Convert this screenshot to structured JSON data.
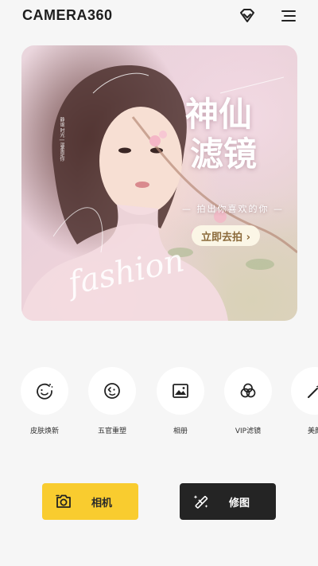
{
  "header": {
    "logo": "CAMERA360",
    "vip_icon": "diamond-icon",
    "menu_icon": "menu-icon"
  },
  "banner": {
    "title_line1": "神仙",
    "title_line2": "滤镜",
    "subtitle": "— 拍出你喜欢的你 —",
    "button_label": "立即去拍 ›",
    "script_text": "fashion",
    "side_text": "静谧 时光 | 温柔是你"
  },
  "features": [
    {
      "label": "皮肤焕新",
      "icon": "face-refresh-icon"
    },
    {
      "label": "五官重塑",
      "icon": "face-reshape-icon"
    },
    {
      "label": "相册",
      "icon": "image-icon"
    },
    {
      "label": "VIP滤镜",
      "icon": "filter-circles-icon"
    },
    {
      "label": "美颜",
      "icon": "magic-wand-icon"
    }
  ],
  "actions": {
    "camera_label": "相机",
    "edit_label": "修图"
  },
  "colors": {
    "accent_yellow": "#f9cc2f",
    "dark_button": "#242424",
    "background": "#f6f6f6"
  }
}
